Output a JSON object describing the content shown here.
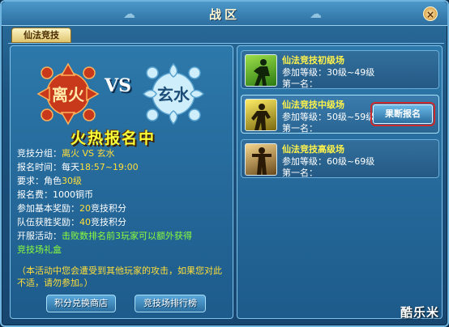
{
  "window": {
    "title": "战区",
    "close_glyph": "×"
  },
  "tab": {
    "label": "仙法竞技"
  },
  "left": {
    "fire_label": "离火",
    "water_label": "玄水",
    "vs": "VS",
    "banner": "火热报名中",
    "rows": [
      {
        "label": "竞技分组：",
        "value": "离火 VS 玄水"
      },
      {
        "label": "报名时间：每天",
        "value": "18:57~19:00"
      },
      {
        "label": "要求：角色",
        "value": "30级"
      },
      {
        "label": "报名费：1000铜币",
        "value": ""
      },
      {
        "label": "参加基本奖励：",
        "value": "20",
        "suffix": "竞技积分"
      },
      {
        "label": "队伍获胜奖励：",
        "value": "40",
        "suffix": "竞技积分"
      },
      {
        "label": "开服活动：",
        "value": "击败数排名前3玩家可以额外获得"
      },
      {
        "label": "",
        "value": "竞技场礼盒"
      }
    ],
    "notice": "（本活动中您会遭受到其他玩家的攻击，如果您对此不适，请勿参加。）",
    "shop_button": "积分兑换商店",
    "rank_button": "竞技场排行榜"
  },
  "arenas": [
    {
      "title": "仙法竞技初级场",
      "level": "参加等级：30级~49级",
      "first": "第一名："
    },
    {
      "title": "仙法竞技中级场",
      "level": "参加等级：50级~59级",
      "first": "第一名：",
      "signup": "果断报名"
    },
    {
      "title": "仙法竞技高级场",
      "level": "参加等级：60级~69级",
      "first": "第一名："
    }
  ],
  "watermark": "酷乐米",
  "colors": {
    "accent": "#ffde3a",
    "green": "#8cff3a",
    "fire": "#d8461c",
    "water": "#bfe6fb"
  }
}
